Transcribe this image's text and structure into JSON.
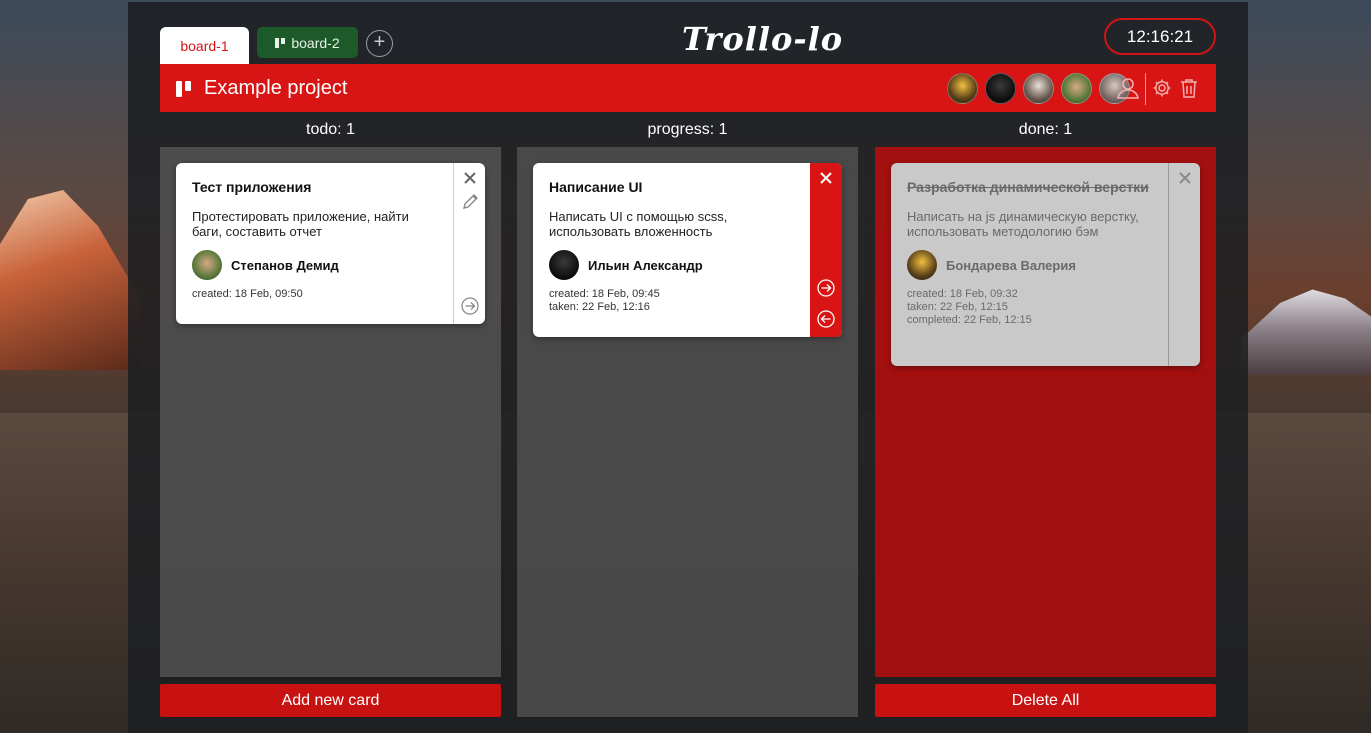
{
  "tabs": [
    {
      "label": "board-1",
      "active": true
    },
    {
      "label": "board-2",
      "active": false
    }
  ],
  "add_tab_label": "+",
  "logo": "Trollo-lo",
  "clock": "12:16:21",
  "project": {
    "title": "Example project"
  },
  "columns": [
    {
      "heading": "todo:  1",
      "cards": [
        {
          "title": "Тест приложения",
          "description": "Протестировать приложение, найти баги, составить отчет",
          "user": "Степанов Демид",
          "dates": [
            "created: 18 Feb, 09:50"
          ]
        }
      ]
    },
    {
      "heading": "progress:  1",
      "cards": [
        {
          "title": "Написание UI",
          "description": "Написать UI с помощью scss, использовать вложенность",
          "user": "Ильин Александр",
          "dates": [
            "created: 18 Feb, 09:45",
            "taken: 22 Feb, 12:16"
          ]
        }
      ]
    },
    {
      "heading": "done:  1",
      "cards": [
        {
          "title": "Разработка динамической верстки",
          "description": "Написать на js динамическую верстку, использовать методологию бэм",
          "user": "Бондарева Валерия",
          "dates": [
            "created: 18 Feb, 09:32",
            "taken: 22 Feb, 12:15",
            "completed: 22 Feb, 12:15"
          ]
        }
      ]
    }
  ],
  "buttons": {
    "add_card": "Add new card",
    "delete_all": "Delete All"
  },
  "colors": {
    "accent": "#d81414",
    "board2": "#1c5a2a",
    "app_bg": "#1c1e22"
  }
}
